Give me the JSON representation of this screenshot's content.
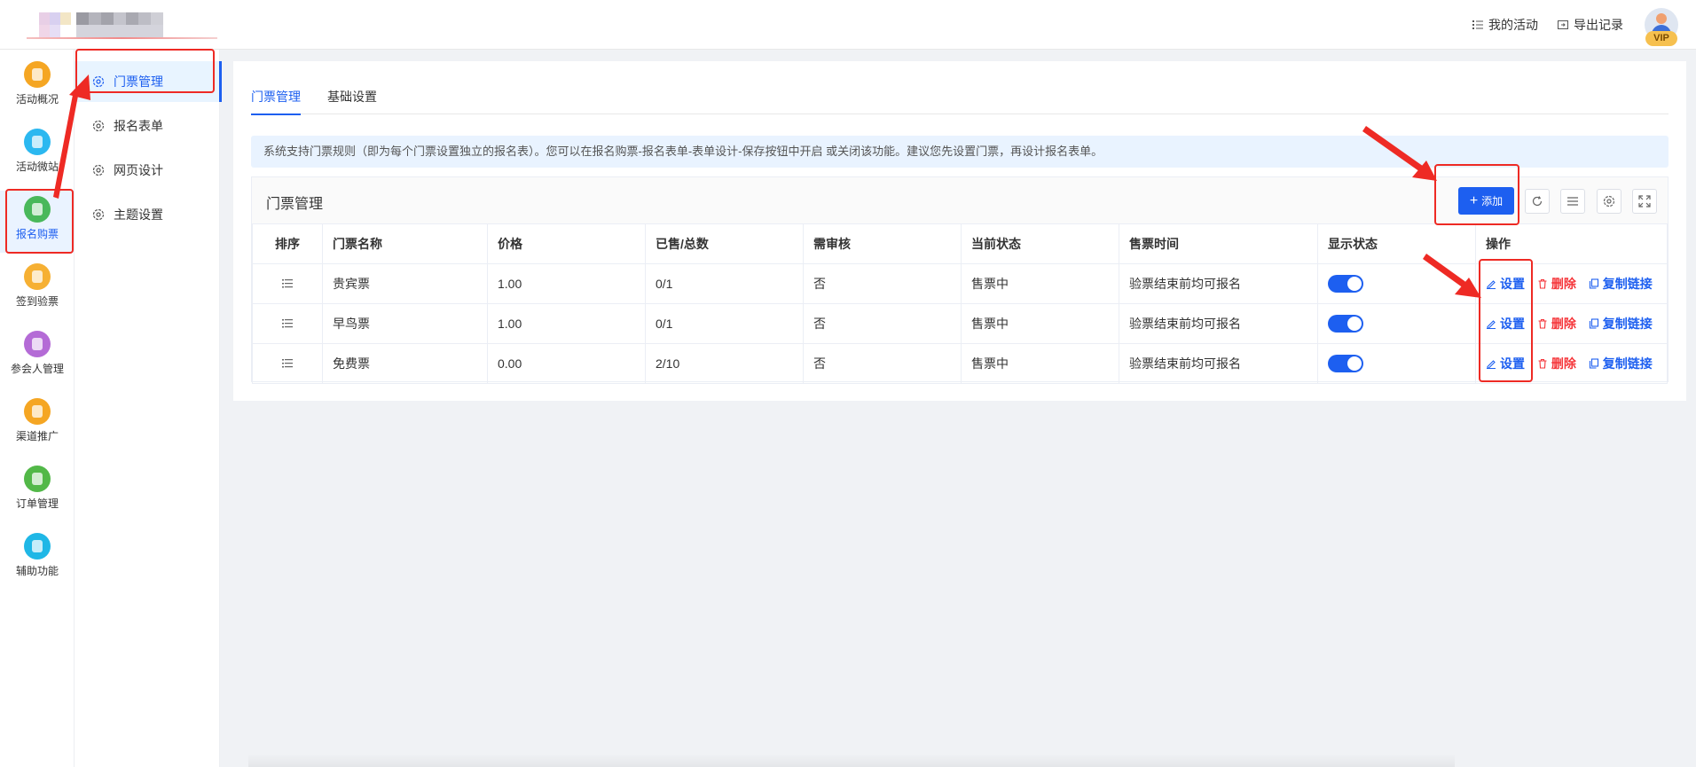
{
  "header": {
    "my_activity": "我的活动",
    "export_records": "导出记录",
    "vip_badge": "VIP"
  },
  "rail": {
    "items": [
      {
        "label": "活动概况",
        "color": "#f5a623"
      },
      {
        "label": "活动微站",
        "color": "#2bb8f0"
      },
      {
        "label": "报名购票",
        "color": "#49b85b"
      },
      {
        "label": "签到验票",
        "color": "#f6b033"
      },
      {
        "label": "参会人管理",
        "color": "#b46bd6"
      },
      {
        "label": "渠道推广",
        "color": "#f5a623"
      },
      {
        "label": "订单管理",
        "color": "#52b848"
      },
      {
        "label": "辅助功能",
        "color": "#1fb7e6"
      }
    ],
    "active_index": 2
  },
  "submenu": {
    "items": [
      "门票管理",
      "报名表单",
      "网页设计",
      "主题设置"
    ],
    "active_index": 0
  },
  "tabs": [
    "门票管理",
    "基础设置"
  ],
  "alert": "系统支持门票规则（即为每个门票设置独立的报名表）。您可以在报名购票-报名表单-表单设计-保存按钮中开启 或关闭该功能。建议您先设置门票，再设计报名表单。",
  "table": {
    "title": "门票管理",
    "add_label": "添加",
    "columns": [
      "排序",
      "门票名称",
      "价格",
      "已售/总数",
      "需审核",
      "当前状态",
      "售票时间",
      "显示状态",
      "操作"
    ],
    "rows": [
      {
        "name": "贵宾票",
        "price": "1.00",
        "sold": "0/1",
        "review": "否",
        "status": "售票中",
        "time": "验票结束前均可报名",
        "visible": true
      },
      {
        "name": "早鸟票",
        "price": "1.00",
        "sold": "0/1",
        "review": "否",
        "status": "售票中",
        "time": "验票结束前均可报名",
        "visible": true
      },
      {
        "name": "免费票",
        "price": "0.00",
        "sold": "2/10",
        "review": "否",
        "status": "售票中",
        "time": "验票结束前均可报名",
        "visible": true
      }
    ],
    "actions": {
      "settings": "设置",
      "delete": "删除",
      "copy_link": "复制链接"
    }
  },
  "colors": {
    "primary": "#1d5ff0",
    "danger": "#f5363a",
    "annotation": "#ee2a24"
  }
}
